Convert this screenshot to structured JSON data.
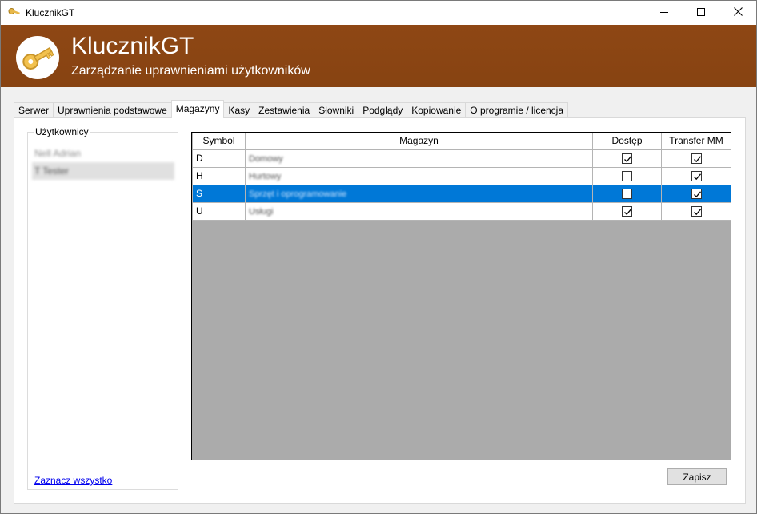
{
  "window": {
    "title": "KlucznikGT",
    "controls": {
      "minimize": "minimize-icon",
      "maximize": "maximize-icon",
      "close": "close-icon"
    }
  },
  "banner": {
    "app_name": "KlucznikGT",
    "subtitle": "Zarządzanie uprawnieniami użytkowników",
    "logo_icon": "key-icon",
    "background_color": "#8b4513"
  },
  "tabs": [
    {
      "label": "Serwer",
      "active": false
    },
    {
      "label": "Uprawnienia podstawowe",
      "active": false
    },
    {
      "label": "Magazyny",
      "active": true
    },
    {
      "label": "Kasy",
      "active": false
    },
    {
      "label": "Zestawienia",
      "active": false
    },
    {
      "label": "Słowniki",
      "active": false
    },
    {
      "label": "Podglądy",
      "active": false
    },
    {
      "label": "Kopiowanie",
      "active": false
    },
    {
      "label": "O programie / licencja",
      "active": false
    }
  ],
  "users": {
    "legend": "Użytkownicy",
    "items": [
      {
        "label": "Nell Adrian",
        "selected": false
      },
      {
        "label": "T Tester",
        "selected": true
      }
    ],
    "select_all_label": "Zaznacz wszystko"
  },
  "grid": {
    "columns": [
      "Symbol",
      "Magazyn",
      "Dostęp",
      "Transfer MM"
    ],
    "rows": [
      {
        "symbol": "D",
        "magazyn": "Domowy",
        "dostep": true,
        "transfer": true,
        "selected": false
      },
      {
        "symbol": "H",
        "magazyn": "Hurtowy",
        "dostep": false,
        "transfer": true,
        "selected": false
      },
      {
        "symbol": "S",
        "magazyn": "Sprzęt i oprogramowanie",
        "dostep": false,
        "transfer": true,
        "selected": true
      },
      {
        "symbol": "U",
        "magazyn": "Usługi",
        "dostep": true,
        "transfer": true,
        "selected": false
      }
    ],
    "selection_color": "#0078d7"
  },
  "actions": {
    "save_label": "Zapisz"
  }
}
